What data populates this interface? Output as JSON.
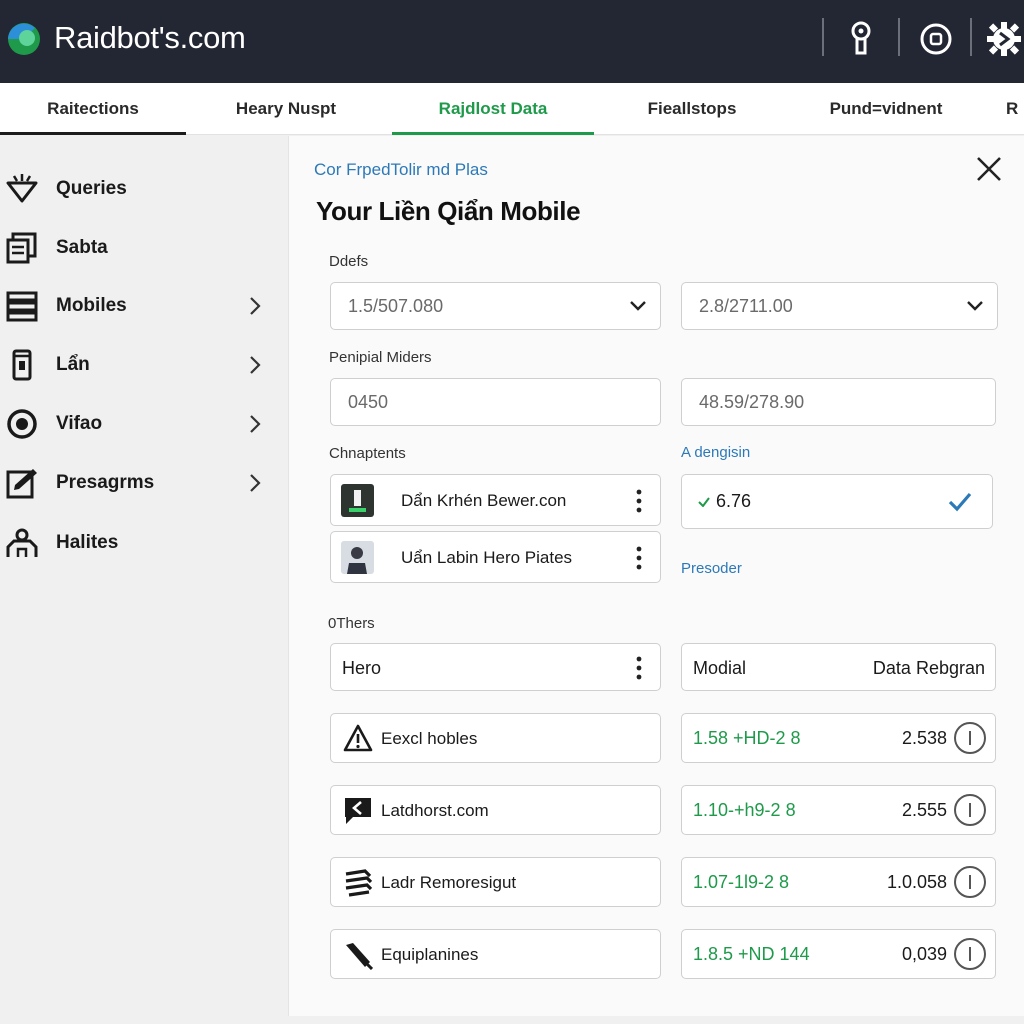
{
  "app": {
    "brand": "Raidbot's.com"
  },
  "topbar": {
    "icons": [
      "keyhole-icon",
      "stop-circle-icon",
      "gear-icon"
    ]
  },
  "tabs": [
    {
      "label": "Raitections"
    },
    {
      "label": "Heary Nuspt"
    },
    {
      "label": "Rajdlost Data"
    },
    {
      "label": "Fieallstops"
    },
    {
      "label": "Pund=vidnent"
    },
    {
      "label": "R"
    }
  ],
  "sidebar": {
    "items": [
      {
        "label": "Queries",
        "icon": "funnel-icon",
        "chevron": false
      },
      {
        "label": "Sabta",
        "icon": "document-icon",
        "chevron": false
      },
      {
        "label": "Mobiles",
        "icon": "stack-icon",
        "chevron": true
      },
      {
        "label": "Lẩn",
        "icon": "phone-icon",
        "chevron": true
      },
      {
        "label": "Vifao",
        "icon": "target-icon",
        "chevron": true
      },
      {
        "label": "Presagrms",
        "icon": "edit-box-icon",
        "chevron": true
      },
      {
        "label": "Halites",
        "icon": "users-icon",
        "chevron": false
      }
    ]
  },
  "panel": {
    "breadcrumb": "Cor FrpedTolir md Plas",
    "title": "Your Liền Qiẩn Mobile",
    "details": {
      "label": "Ddefs",
      "select_left": "1.5/507.080",
      "select_right": "2.8/2711.00"
    },
    "peripheral": {
      "label": "Penipial Miders",
      "input_left": "0450",
      "input_right": "48.59/278.90"
    },
    "components": {
      "label": "Chnaptents",
      "items": [
        {
          "name": "Dẩn Krhén Bewer.con"
        },
        {
          "name": "Uẩn Labin Hero Piates"
        }
      ]
    },
    "design": {
      "label": "A dengisin",
      "value": "6.76",
      "provider_label": "Presoder"
    },
    "others": {
      "label": "0Thers",
      "header_left": "Hero",
      "header_mid": "Modial",
      "header_right": "Data Rebgran",
      "rows": [
        {
          "name": "Eexcl hobles",
          "icon": "warning-icon",
          "range": "1.58 +HD-2 8",
          "value": "2.538"
        },
        {
          "name": "Latdhorst.com",
          "icon": "back-message-icon",
          "range": "1.10-+h9-2 8",
          "value": "2.555"
        },
        {
          "name": "Ladr Remoresigut",
          "icon": "layers-icon",
          "range": "1.07-1l9-2 8",
          "value": "1.0.058"
        },
        {
          "name": "Equiplanines",
          "icon": "tool-icon",
          "range": "1.8.5 +ND 144",
          "value": "0,039"
        }
      ]
    }
  },
  "colors": {
    "topbar": "#232633",
    "accent_green": "#1e9a4a",
    "link_blue": "#2d79b8"
  }
}
